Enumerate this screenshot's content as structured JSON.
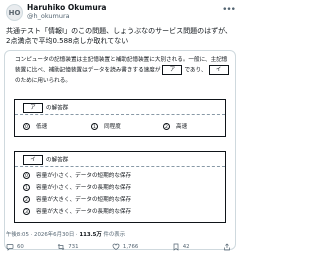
{
  "author": {
    "name": "Haruhiko Okumura",
    "handle": "@h_okumura",
    "avatar_text": "HO"
  },
  "tweet_text": "共通テスト「情報I」のこの問題、しょうぶなのサービス問題のはずが、2点満点で平均0.588点しか取れてない",
  "question": {
    "text_1": "コンピュータの記憶装置は主記憶装置と補助記憶装置に大別される。一般に、主記憶装置に比べ、補助記憶装置はデータを読み書きする速度が",
    "blank_a": "ア",
    "text_2": "であり、",
    "blank_i": "イ",
    "text_3": "のために用いられる。"
  },
  "answer_a": {
    "label_suffix": "の解答群",
    "options": [
      {
        "num": "0",
        "text": "低速"
      },
      {
        "num": "1",
        "text": "同程度"
      },
      {
        "num": "2",
        "text": "高速"
      }
    ]
  },
  "answer_i": {
    "label_suffix": "の解答群",
    "options": [
      {
        "num": "0",
        "text": "容量が小さく、データの短期的な保存"
      },
      {
        "num": "1",
        "text": "容量が小さく、データの長期的な保存"
      },
      {
        "num": "2",
        "text": "容量が大きく、データの短期的な保存"
      },
      {
        "num": "3",
        "text": "容量が大きく、データの長期的な保存"
      }
    ]
  },
  "meta": {
    "time": "午後8:05 · 2026年6月30日 · ",
    "views": "113.5万",
    "views_suffix": " 件の表示"
  },
  "actions": {
    "reply": "60",
    "retweet": "731",
    "like": "1,766",
    "bookmark": "42"
  }
}
